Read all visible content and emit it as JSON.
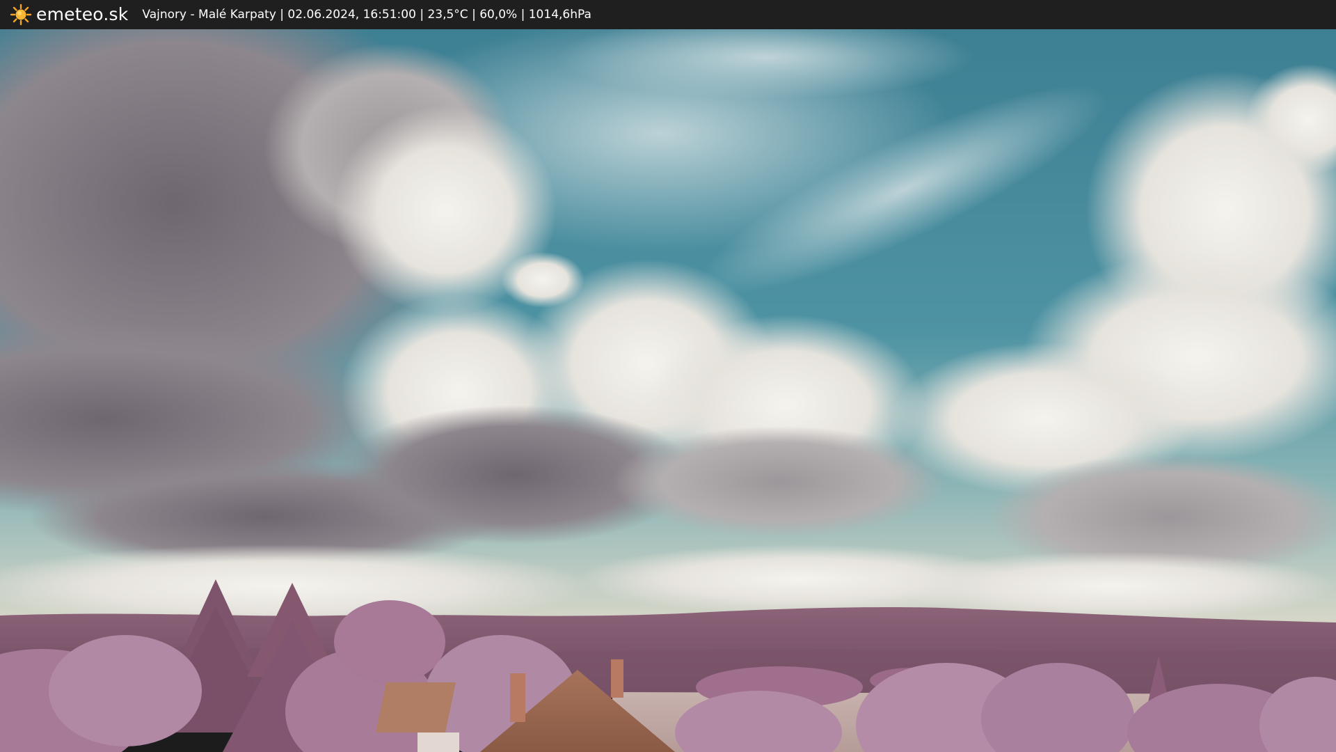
{
  "topbar": {
    "brand": "emeteo.sk",
    "info": "Vajnory - Malé Karpaty | 02.06.2024, 16:51:00 | 23,5°C | 60,0% | 1014,6hPa"
  },
  "icons": {
    "logo": "sun-icon"
  },
  "colors": {
    "topbar_bg": "#1f1f1f",
    "sun": "#f5a623",
    "sky": "#3f8596",
    "foliage": "#a87899"
  }
}
